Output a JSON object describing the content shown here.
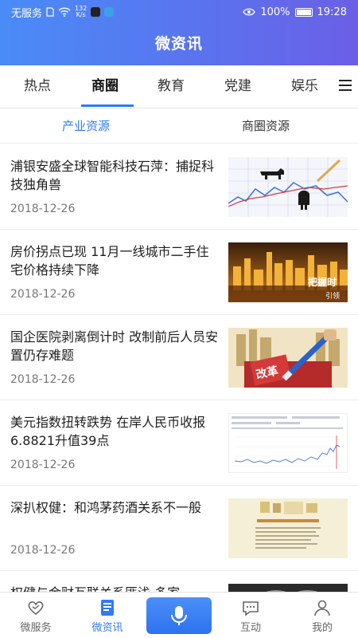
{
  "status_bar": {
    "carrier": "无服务",
    "speed_value": "132",
    "speed_unit": "K/s",
    "battery": "100%",
    "time": "19:28"
  },
  "header": {
    "title": "微资讯"
  },
  "tabs": [
    {
      "label": "热点",
      "active": false
    },
    {
      "label": "商圈",
      "active": true
    },
    {
      "label": "教育",
      "active": false
    },
    {
      "label": "党建",
      "active": false
    },
    {
      "label": "娱乐",
      "active": false
    }
  ],
  "subtabs": [
    {
      "label": "产业资源",
      "active": true
    },
    {
      "label": "商圈资源",
      "active": false
    }
  ],
  "news": [
    {
      "title": "浦银安盛全球智能科技石萍：捕捉科技独角兽",
      "date": "2018-12-26",
      "thumb": "bull-bear-chart"
    },
    {
      "title": "房价拐点已现 11月一线城市二手住宅价格持续下降",
      "date": "2018-12-26",
      "thumb": "city-skyline"
    },
    {
      "title": "国企医院剥离倒计时 改制前后人员安置仍存难题",
      "date": "2018-12-26",
      "thumb": "reform-pen"
    },
    {
      "title": "美元指数扭转跌势 在岸人民币收报6.8821升值39点",
      "date": "2018-12-26",
      "thumb": "line-chart-screenshot"
    },
    {
      "title": "深扒权健：和鸿茅药酒关系不一般",
      "date": "2018-12-26",
      "thumb": "document-scan"
    },
    {
      "title": "权健与金财互联关系匪浅 多家",
      "date": "",
      "thumb": "dark-photo"
    }
  ],
  "thumb_text": {
    "reform_badge": "改革",
    "skyline_caption_1": "把握时",
    "skyline_caption_2": "引领"
  },
  "tabbar": [
    {
      "label": "微服务",
      "icon": "heart-icon",
      "active": false
    },
    {
      "label": "微资讯",
      "icon": "document-icon",
      "active": true
    },
    {
      "label": "",
      "icon": "microphone-icon",
      "active": false
    },
    {
      "label": "互动",
      "icon": "chat-icon",
      "active": false
    },
    {
      "label": "我的",
      "icon": "person-icon",
      "active": false
    }
  ],
  "colors": {
    "accent": "#2e7cf6",
    "header_start": "#4a8cf7",
    "header_end": "#6b5fe6"
  }
}
